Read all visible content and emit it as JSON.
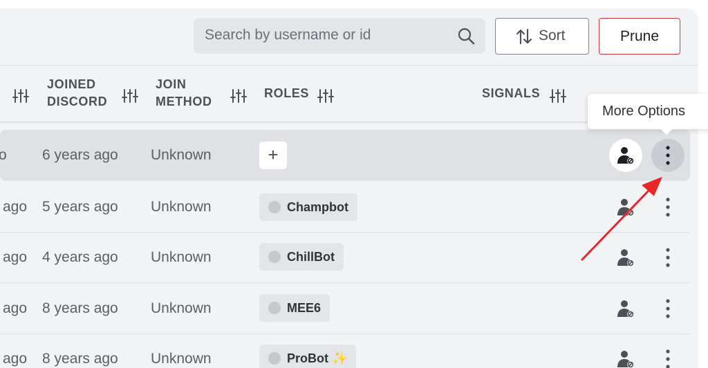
{
  "toolbar": {
    "search_placeholder": "Search by username or id",
    "search_icon": "search-icon",
    "sort_label": "Sort",
    "sort_icon": "sort-arrows-icon",
    "prune_label": "Prune"
  },
  "columns": {
    "joined_discord": [
      "JOINED",
      "DISCORD"
    ],
    "join_method": [
      "JOIN",
      "METHOD"
    ],
    "roles": "ROLES",
    "signals": "SIGNALS",
    "filter_icon": "filter-sliders-icon"
  },
  "rows": [
    {
      "member_since_fragment": "o",
      "joined_discord": "6 years ago",
      "join_method": "Unknown",
      "role": null,
      "add_role_label": "+"
    },
    {
      "member_since_fragment": "ago",
      "joined_discord": "5 years ago",
      "join_method": "Unknown",
      "role": "Champbot"
    },
    {
      "member_since_fragment": "ago",
      "joined_discord": "4 years ago",
      "join_method": "Unknown",
      "role": "ChillBot"
    },
    {
      "member_since_fragment": "ago",
      "joined_discord": "8 years ago",
      "join_method": "Unknown",
      "role": "MEE6"
    },
    {
      "member_since_fragment": "ago",
      "joined_discord": "8 years ago",
      "join_method": "Unknown",
      "role": "ProBot ✨"
    }
  ],
  "tooltip": {
    "text": "More Options"
  },
  "colors": {
    "panel_bg": "#f2f3f5",
    "highlight_row": "#dfe1e5",
    "prune_border": "#da373c",
    "annotation_arrow": "#e8262a"
  }
}
